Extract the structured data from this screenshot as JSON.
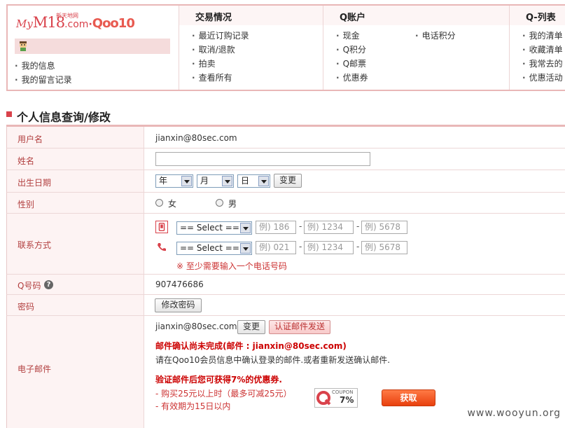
{
  "logo": {
    "my": "My",
    "m18": "M18",
    "com": ".com",
    "dot": "·",
    "qoo10": "Qoo10",
    "sub": "新天地网"
  },
  "sidebar": {
    "items": [
      {
        "label": "我的信息"
      },
      {
        "label": "我的留言记录"
      }
    ]
  },
  "nav": {
    "trade": {
      "title": "交易情况",
      "items": [
        "最近订购记录",
        "取消/退款",
        "拍卖",
        "查看所有"
      ]
    },
    "account": {
      "title": "Q账户",
      "items": [
        "现金",
        "Q积分",
        "Q邮票",
        "优惠券",
        "电话积分"
      ]
    },
    "qlist": {
      "title": "Q-列表",
      "items": [
        "我的清单",
        "收藏清单",
        "我常去的",
        "优惠活动"
      ]
    }
  },
  "section": {
    "title": "个人信息查询/修改"
  },
  "form": {
    "username": {
      "label": "用户名",
      "value": "jianxin@80sec.com"
    },
    "name": {
      "label": "姓名",
      "value": ""
    },
    "birthday": {
      "label": "出生日期",
      "year": "年",
      "month": "月",
      "day": "日",
      "change": "变更"
    },
    "gender": {
      "label": "性别",
      "female": "女",
      "male": "男"
    },
    "contact": {
      "label": "联系方式",
      "mobile": {
        "select": "== Select ==",
        "p1": "例) 186",
        "p2": "例) 1234",
        "p3": "例) 5678"
      },
      "phone": {
        "select": "== Select ==",
        "p1": "例) 021",
        "p2": "例) 1234",
        "p3": "例) 5678"
      },
      "note": "※ 至少需要输入一个电话号码"
    },
    "qnumber": {
      "label": "Q号码",
      "value": "907476686"
    },
    "password": {
      "label": "密码",
      "button": "修改密码"
    },
    "email": {
      "label": "电子邮件",
      "value": "jianxin@80sec.com",
      "change": "变更",
      "send": "认证邮件发送",
      "warning": "邮件确认尚未完成(邮件 : jianxin@80sec.com)",
      "info": "请在Qoo10会员信息中确认登录的邮件.或者重新发送确认邮件.",
      "promo_title": "验证邮件后您可获得7%的优惠券.",
      "promo_line1": "- 购买25元以上时（最多可减25元）",
      "promo_line2": "- 有效期为15日以内",
      "coupon_label": "COUPON",
      "coupon_pct": "7%",
      "get": "获取"
    }
  },
  "watermark": "www.wooyun.org",
  "colors": {
    "accent": "#d9424b",
    "label_text": "#b24040",
    "warning": "#cc0000",
    "get_button": "#ef5a25"
  }
}
